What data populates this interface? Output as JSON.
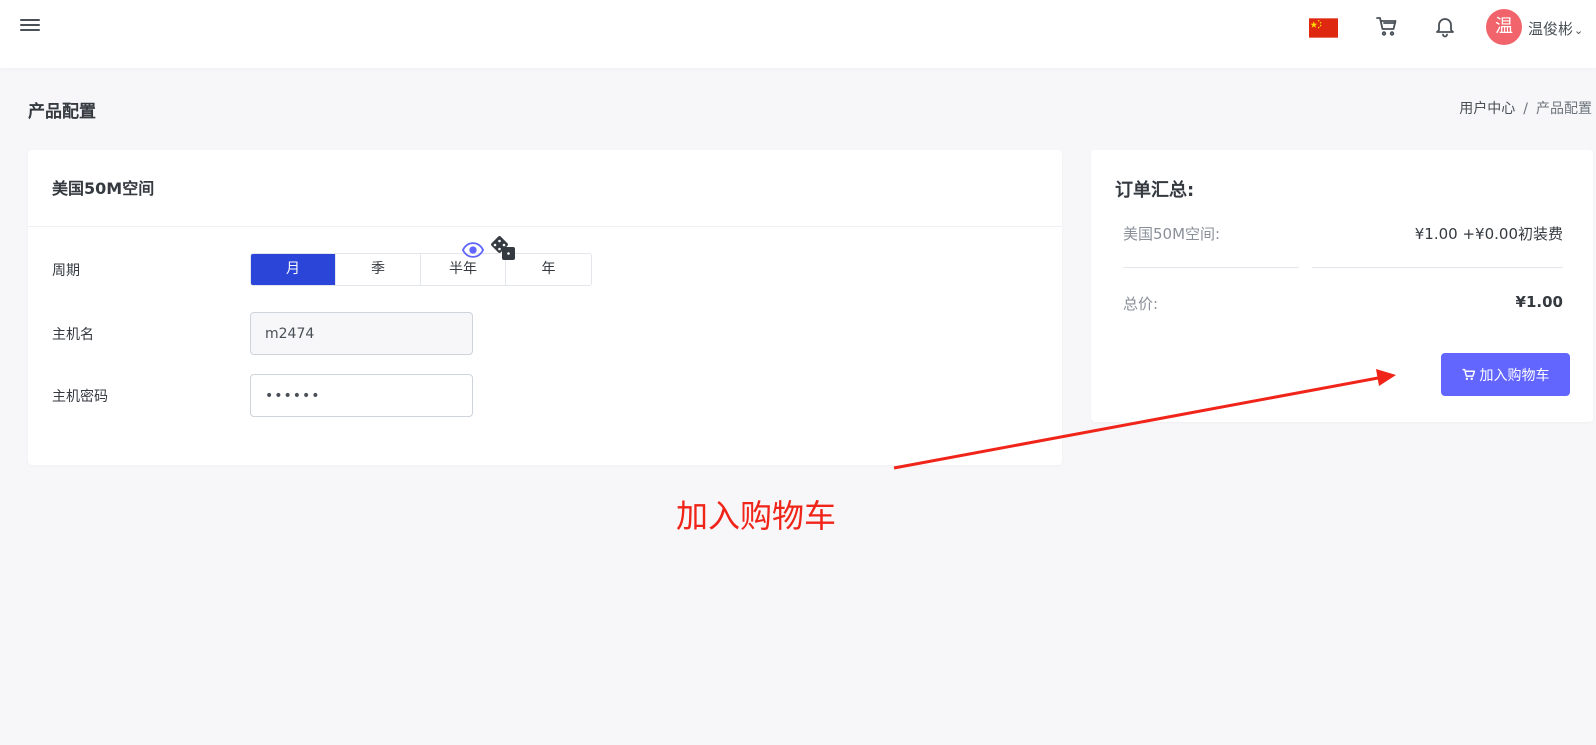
{
  "header": {
    "menu_icon": "hamburger-icon",
    "flag_icon": "china-flag-icon",
    "cart_icon": "cart-icon",
    "bell_icon": "bell-icon",
    "avatar_text": "温",
    "avatar_color": "#f1646c",
    "username": "温俊彬"
  },
  "page": {
    "title": "产品配置",
    "breadcrumb": [
      "用户中心",
      "产品配置"
    ]
  },
  "product": {
    "name": "美国50M空间",
    "cycle_label": "周期",
    "cycles": [
      "月",
      "季",
      "半年",
      "年"
    ],
    "cycle_selected": "月",
    "hostname_label": "主机名",
    "hostname_value": "m2474",
    "password_label": "主机密码",
    "password_value": "••••••"
  },
  "summary": {
    "title": "订单汇总:",
    "item_name": "美国50M空间:",
    "item_price": "¥1.00 +¥0.00初装费",
    "total_label": "总价:",
    "total_value": "¥1.00",
    "add_to_cart_label": "加入购物车"
  },
  "annotation": {
    "text": "加入购物车",
    "color": "#f02419"
  },
  "colors": {
    "primary": "#2a45d8",
    "button": "#6266ff",
    "background": "#f7f7f9"
  }
}
